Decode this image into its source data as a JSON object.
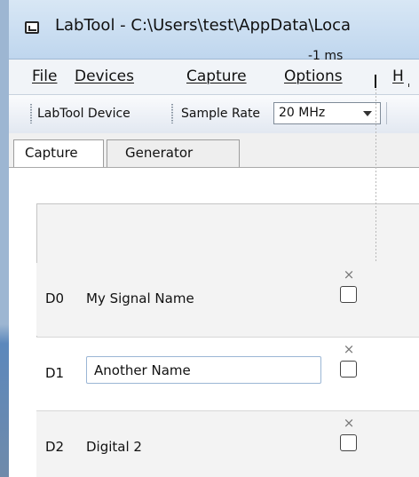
{
  "window": {
    "title": "LabTool - C:\\Users\\test\\AppData\\Loca",
    "icon": "app-window-icon"
  },
  "menu": {
    "items": [
      "File",
      "Devices",
      "Capture",
      "Options",
      "H"
    ]
  },
  "toolbar": {
    "device_button": "LabTool Device",
    "sample_rate_label": "Sample Rate",
    "sample_rate_value": "20 MHz"
  },
  "tabs": [
    {
      "label": "Capture",
      "selected": true
    },
    {
      "label": "Generator",
      "selected": false
    }
  ],
  "capture": {
    "time_label": "-1 ms",
    "signals": [
      {
        "id": "D0",
        "name": "My Signal Name",
        "editing": false
      },
      {
        "id": "D1",
        "name": "Another Name",
        "editing": true
      },
      {
        "id": "D2",
        "name": "Digital 2",
        "editing": false
      }
    ]
  },
  "icons": {
    "remove": "close-icon",
    "dropdown": "chevron-down-icon",
    "toolbar_grip": "drag-grip-icon"
  },
  "colors": {
    "title_bar": "#bfd6ee",
    "selected_tab": "#ffffff",
    "panel_background": "#f3f3f3",
    "input_border": "#9bb6d5"
  }
}
